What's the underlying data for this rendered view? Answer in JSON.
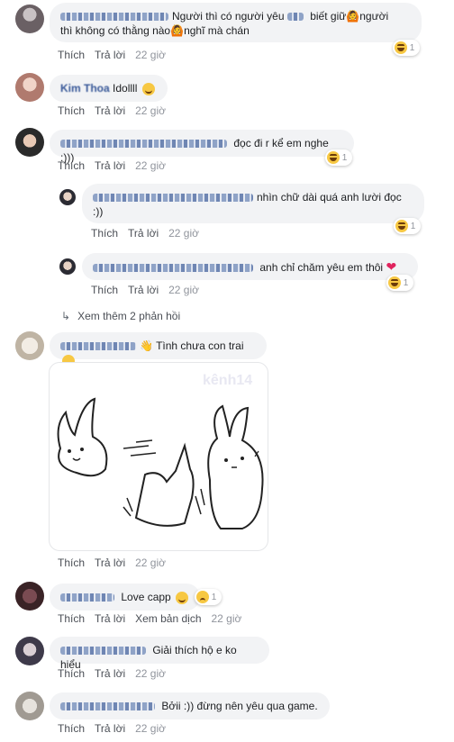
{
  "comments": [
    {
      "text_before": "Người thì có người yêu",
      "text_after": "biết giữ",
      "text_line2_a": "người",
      "text_line2_b": "thì không có thằng nào",
      "text_line2_c": "nghĩ mà chán",
      "actions": {
        "like": "Thích",
        "reply": "Trả lời",
        "time": "22 giờ"
      },
      "reaction_count": "1"
    },
    {
      "name": "Kim Thoa",
      "text": "Idollll",
      "actions": {
        "like": "Thích",
        "reply": "Trả lời",
        "time": "22 giờ"
      }
    },
    {
      "text": "đọc đi r kể em nghe :)))",
      "actions": {
        "like": "Thích",
        "reply": "Trả lời",
        "time": "22 giờ"
      },
      "reaction_count": "1",
      "replies": [
        {
          "text_line1": "nhìn chữ dài quá anh lười đọc",
          "text_line2": ":))",
          "actions": {
            "like": "Thích",
            "reply": "Trả lời",
            "time": "22 giờ"
          },
          "reaction_count": "1"
        },
        {
          "text": "anh chỉ chăm yêu em thôi",
          "actions": {
            "like": "Thích",
            "reply": "Trả lời",
            "time": "22 giờ"
          },
          "reaction_count": "1"
        }
      ],
      "see_more": "Xem thêm 2 phản hồi"
    },
    {
      "text": "Tình chưa con trai",
      "sticker_watermark": "kênh14",
      "actions": {
        "like": "Thích",
        "reply": "Trả lời",
        "time": "22 giờ"
      }
    },
    {
      "text": "Love capp",
      "reaction_count": "1",
      "actions": {
        "like": "Thích",
        "reply": "Trả lời",
        "translate": "Xem bản dịch",
        "time": "22 giờ"
      }
    },
    {
      "text": "Giải thích hộ e ko hiểu",
      "actions": {
        "like": "Thích",
        "reply": "Trả lời",
        "time": "22 giờ"
      }
    },
    {
      "text": "Bởii :)) đừng nên yêu qua game.",
      "actions": {
        "like": "Thích",
        "reply": "Trả lời",
        "time": "22 giờ"
      }
    }
  ]
}
